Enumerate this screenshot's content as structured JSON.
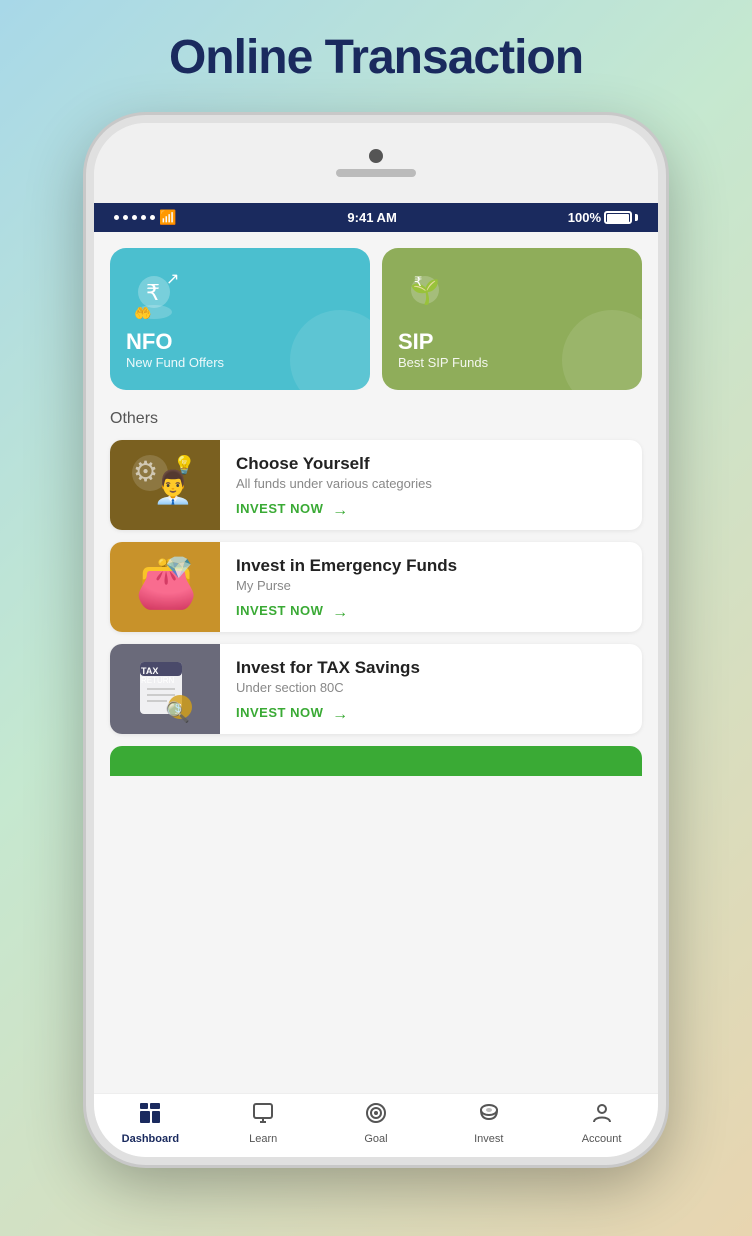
{
  "page": {
    "title": "Online Transaction",
    "background": "gradient"
  },
  "statusBar": {
    "time": "9:41 AM",
    "battery": "100%",
    "signal_dots": 5
  },
  "topCards": [
    {
      "id": "nfo",
      "title": "NFO",
      "subtitle": "New Fund Offers",
      "icon": "💰",
      "bg": "#4bbfcf"
    },
    {
      "id": "sip",
      "title": "SIP",
      "subtitle": "Best SIP Funds",
      "icon": "🌱",
      "bg": "#8fad5a"
    }
  ],
  "othersLabel": "Others",
  "listItems": [
    {
      "id": "choose-yourself",
      "title": "Choose Yourself",
      "subtitle": "All funds under various categories",
      "investLabel": "INVEST NOW",
      "thumbIcon": "🧑‍💼",
      "thumbBg": "#7a6020"
    },
    {
      "id": "emergency-funds",
      "title": "Invest in Emergency Funds",
      "subtitle": "My Purse",
      "investLabel": "INVEST NOW",
      "thumbIcon": "👜",
      "thumbBg": "#c8922a"
    },
    {
      "id": "tax-savings",
      "title": "Invest for TAX Savings",
      "subtitle": "Under section 80C",
      "investLabel": "INVEST NOW",
      "thumbIcon": "📋",
      "thumbBg": "#6a6a7a"
    }
  ],
  "bottomNav": [
    {
      "id": "dashboard",
      "label": "Dashboard",
      "icon": "⊞",
      "active": true
    },
    {
      "id": "learn",
      "label": "Learn",
      "icon": "🖥",
      "active": false
    },
    {
      "id": "goal",
      "label": "Goal",
      "icon": "🎯",
      "active": false
    },
    {
      "id": "invest",
      "label": "Invest",
      "icon": "🐷",
      "active": false
    },
    {
      "id": "account",
      "label": "Account",
      "icon": "👤",
      "active": false
    }
  ]
}
